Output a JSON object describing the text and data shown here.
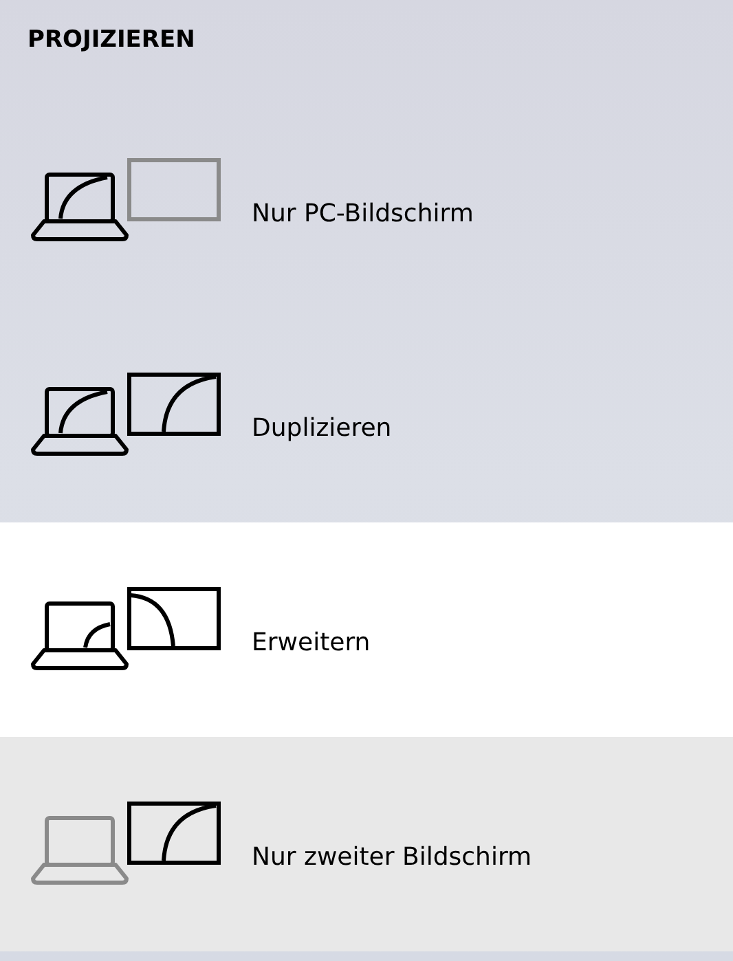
{
  "title": "PROJIZIEREN",
  "options": [
    {
      "kind": "pc_only",
      "label": "Nur PC-Bildschirm",
      "selected": false,
      "hovered": false
    },
    {
      "kind": "duplicate",
      "label": "Duplizieren",
      "selected": false,
      "hovered": false
    },
    {
      "kind": "extend",
      "label": "Erweitern",
      "selected": true,
      "hovered": false
    },
    {
      "kind": "second_only",
      "label": "Nur zweiter Bildschirm",
      "selected": false,
      "hovered": true
    }
  ]
}
